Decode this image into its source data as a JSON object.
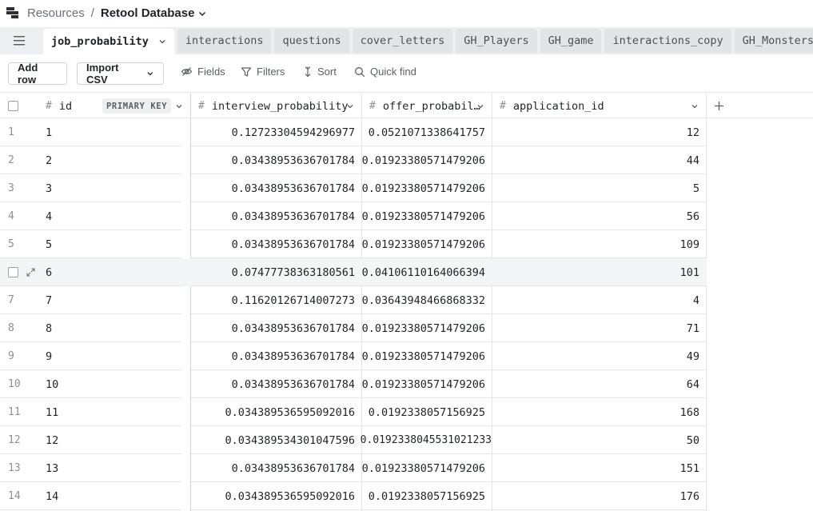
{
  "breadcrumb": {
    "parent": "Resources",
    "separator": "/",
    "current": "Retool Database"
  },
  "tabs": [
    {
      "label": "job_probability",
      "active": true
    },
    {
      "label": "interactions"
    },
    {
      "label": "questions"
    },
    {
      "label": "cover_letters"
    },
    {
      "label": "GH_Players"
    },
    {
      "label": "GH_game"
    },
    {
      "label": "interactions_copy"
    },
    {
      "label": "GH_Monsters"
    }
  ],
  "toolbar": {
    "add_row": "Add row",
    "import_csv": "Import CSV",
    "fields": "Fields",
    "filters": "Filters",
    "sort": "Sort",
    "quick_find": "Quick find"
  },
  "columns": {
    "id": "id",
    "primary_key": "PRIMARY KEY",
    "interview": "interview_probability",
    "offer": "offer_probabil…",
    "application": "application_id"
  },
  "rows": [
    {
      "n": "1",
      "id": "1",
      "interview": "0.12723304594296977",
      "offer": "0.0521071338641757",
      "app": "12"
    },
    {
      "n": "2",
      "id": "2",
      "interview": "0.03438953636701784",
      "offer": "0.01923380571479206",
      "app": "44"
    },
    {
      "n": "3",
      "id": "3",
      "interview": "0.03438953636701784",
      "offer": "0.01923380571479206",
      "app": "5"
    },
    {
      "n": "4",
      "id": "4",
      "interview": "0.03438953636701784",
      "offer": "0.01923380571479206",
      "app": "56"
    },
    {
      "n": "5",
      "id": "5",
      "interview": "0.03438953636701784",
      "offer": "0.01923380571479206",
      "app": "109"
    },
    {
      "n": "",
      "id": "6",
      "interview": "0.07477738363180561",
      "offer": "0.04106110164066394",
      "app": "101"
    },
    {
      "n": "7",
      "id": "7",
      "interview": "0.11620126714007273",
      "offer": "0.03643948466868332",
      "app": "4"
    },
    {
      "n": "8",
      "id": "8",
      "interview": "0.03438953636701784",
      "offer": "0.01923380571479206",
      "app": "71"
    },
    {
      "n": "9",
      "id": "9",
      "interview": "0.03438953636701784",
      "offer": "0.01923380571479206",
      "app": "49"
    },
    {
      "n": "10",
      "id": "10",
      "interview": "0.03438953636701784",
      "offer": "0.01923380571479206",
      "app": "64"
    },
    {
      "n": "11",
      "id": "11",
      "interview": "0.034389536595092016",
      "offer": "0.0192338057156925",
      "app": "168"
    },
    {
      "n": "12",
      "id": "12",
      "interview": "0.034389534301047596",
      "offer": "0.0192338045531021233",
      "app": "50"
    },
    {
      "n": "13",
      "id": "13",
      "interview": "0.03438953636701784",
      "offer": "0.01923380571479206",
      "app": "151"
    },
    {
      "n": "14",
      "id": "14",
      "interview": "0.034389536595092016",
      "offer": "0.0192338057156925",
      "app": "176"
    }
  ]
}
